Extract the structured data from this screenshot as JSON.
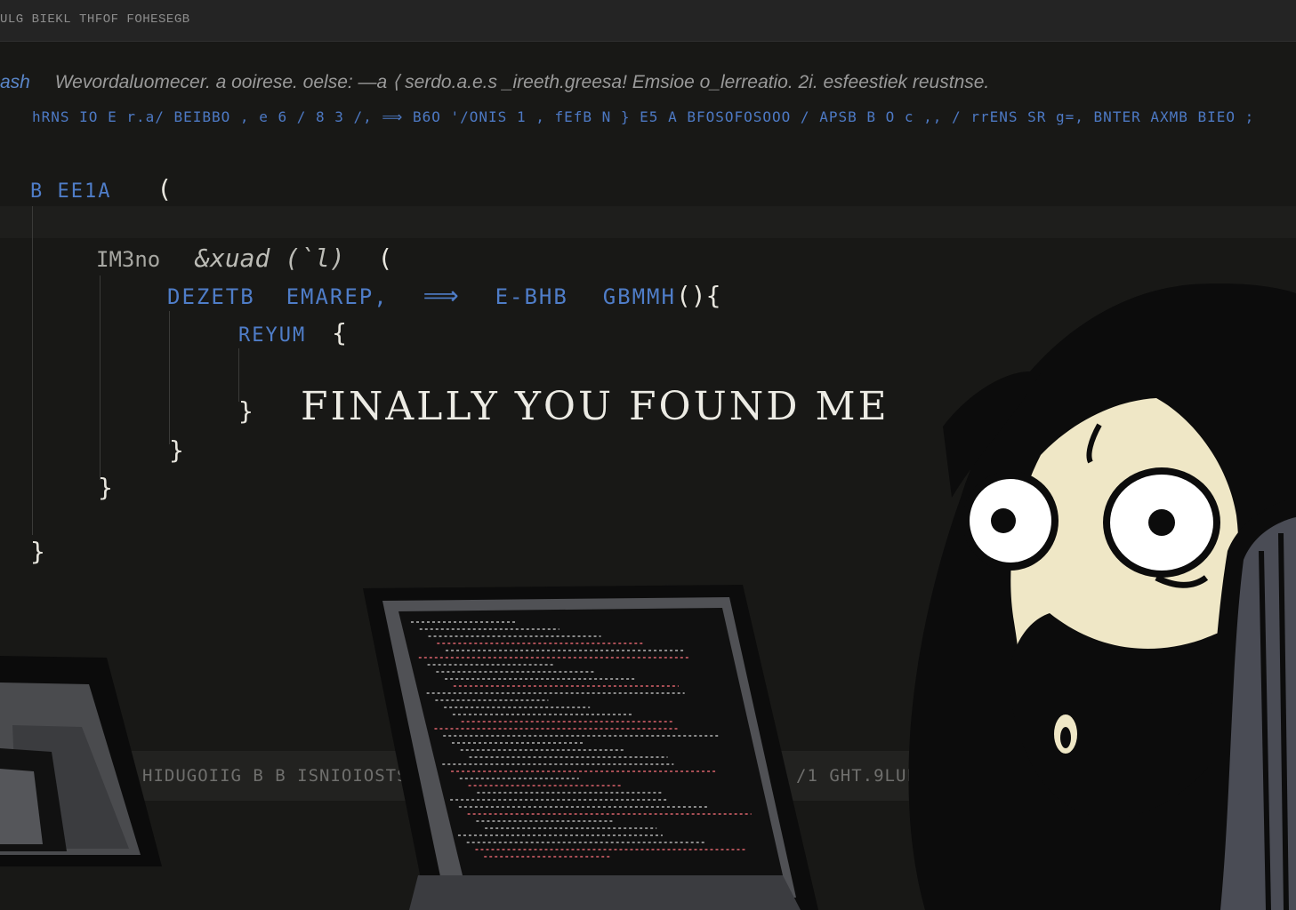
{
  "window": {
    "title": "ULG BIEKL THFOF FOHESEGB"
  },
  "header": {
    "lang": "ash",
    "text": "Wevordaluomecer. a ooirese. oelse: —a ⟨ serdo.a.e.s _ireeth.greesa! Emsioe o_lerreatio. 2i. esfeestiek reustnse.",
    "subtext": "hRNS IO E  r.a/ BEIBBO  ,  e 6 / 8 3 /,  ⟹  B6O '/ONIS 1  , fEfB N }  E5 A BFOSOFOSOOO / APSB B O  c ,,  / rrENS SR g=,  BNTER AXMB BIEO ;"
  },
  "code": {
    "line1_kw": "B EE1A",
    "line1_brace": "(",
    "line2_name": "IM3no",
    "line2_fn": "&xuad (`l)",
    "line2_brace": "(",
    "line3_a": "DEZETB",
    "line3_b": "EMAREP,",
    "line3_arrow": "⟹",
    "line3_c": "E-BHB",
    "line3_d": "GBMMH",
    "line3_tail": "(){",
    "line4_kw": "REYUM",
    "line4_brace": "{",
    "line5_brace": "}",
    "message": "FINALLY YOU FOUND ME",
    "line6_brace": "}",
    "line7_brace": "}",
    "line8_brace": "}"
  },
  "footer": {
    "left": "HIDUGOIIG B  B ISNIOIOSTS ISIOIU",
    "right": "/1 GHT.9LUEK.9OSEUNIUIS B"
  },
  "illustration": {
    "laptop_icon": "laptop-icon",
    "monitor_icon": "monitor-icon",
    "character_icon": "character-icon",
    "chair_icon": "chair-icon"
  }
}
